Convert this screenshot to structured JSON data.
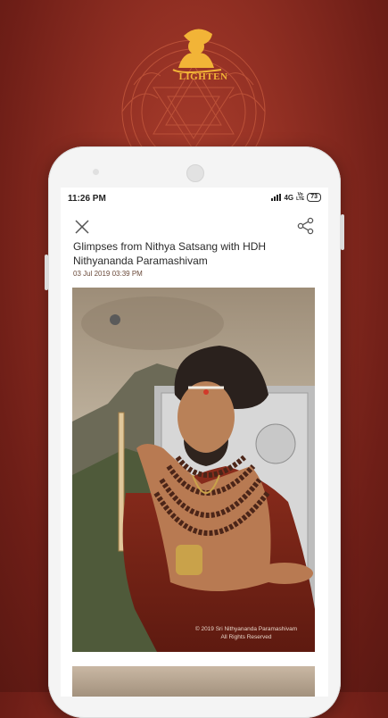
{
  "brand": {
    "name": "LIGHTEN"
  },
  "status": {
    "time": "11:26 PM",
    "network": "4G",
    "volte_top": "Vo",
    "volte_bottom": "LTE",
    "battery": "73"
  },
  "article": {
    "title": "Glimpses from Nithya Satsang with HDH Nithyananda Paramashivam",
    "date": "03 Jul 2019 03:39 PM",
    "watermark_line1": "© 2019 Sri Nithyananda Paramashivam",
    "watermark_line2": "All Rights Reserved"
  },
  "icons": {
    "close": "close-icon",
    "share": "share-icon"
  },
  "colors": {
    "background": "#8f2e22",
    "accent": "#f2b437"
  }
}
